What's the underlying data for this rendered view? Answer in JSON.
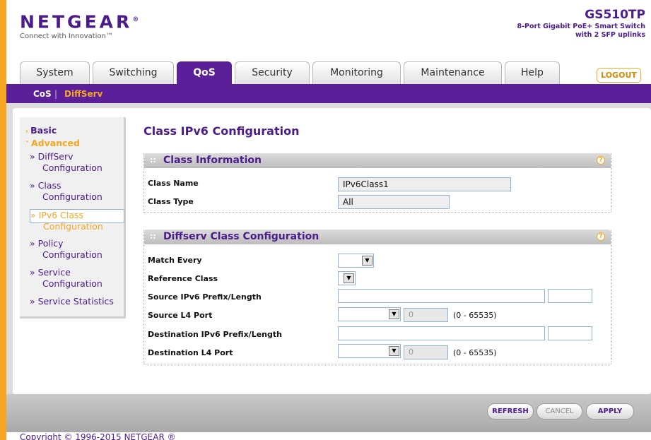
{
  "header": {
    "brand": "NETGEAR",
    "trademark": "®",
    "tagline": "Connect with Innovation™",
    "model": "GS510TP",
    "description_line1": "8-Port Gigabit PoE+ Smart Switch",
    "description_line2": "with 2 SFP uplinks"
  },
  "tabs": [
    {
      "label": "System",
      "active": false
    },
    {
      "label": "Switching",
      "active": false
    },
    {
      "label": "QoS",
      "active": true
    },
    {
      "label": "Security",
      "active": false
    },
    {
      "label": "Monitoring",
      "active": false
    },
    {
      "label": "Maintenance",
      "active": false
    },
    {
      "label": "Help",
      "active": false
    }
  ],
  "logout_label": "LOGOUT",
  "subnav": {
    "cos": "CoS",
    "separator": "|",
    "diffserv": "DiffServ"
  },
  "left_nav": {
    "basic": "Basic",
    "advanced": "Advanced",
    "items": [
      {
        "line1": "» DiffServ",
        "line2": "Configuration"
      },
      {
        "line1": "» Class",
        "line2": "Configuration"
      },
      {
        "line1": "» IPv6 Class",
        "line2": "Configuration"
      },
      {
        "line1": "» Policy",
        "line2": "Configuration"
      },
      {
        "line1": "» Service",
        "line2": "Configuration"
      },
      {
        "line1": "» Service Statistics",
        "line2": ""
      }
    ]
  },
  "page_title": "Class IPv6 Configuration",
  "class_info": {
    "title": "Class Information",
    "class_name_label": "Class Name",
    "class_name_value": "IPv6Class1",
    "class_type_label": "Class Type",
    "class_type_value": "All"
  },
  "diffserv_config": {
    "title": "Diffserv Class Configuration",
    "match_every_label": "Match Every",
    "reference_class_label": "Reference Class",
    "source_prefix_label": "Source IPv6 Prefix/Length",
    "source_l4_label": "Source L4 Port",
    "source_l4_value": "0",
    "source_l4_range": "(0 - 65535)",
    "dest_prefix_label": "Destination IPv6 Prefix/Length",
    "dest_l4_label": "Destination L4 Port",
    "dest_l4_value": "0",
    "dest_l4_range": "(0 - 65535)"
  },
  "buttons": {
    "refresh": "REFRESH",
    "cancel": "CANCEL",
    "apply": "APPLY"
  },
  "copyright": "Copyright © 1996-2015 NETGEAR ®",
  "colors": {
    "brand_purple": "#4c1c8c",
    "accent_orange": "#f5a623",
    "tab_active": "#5b1f9a"
  }
}
